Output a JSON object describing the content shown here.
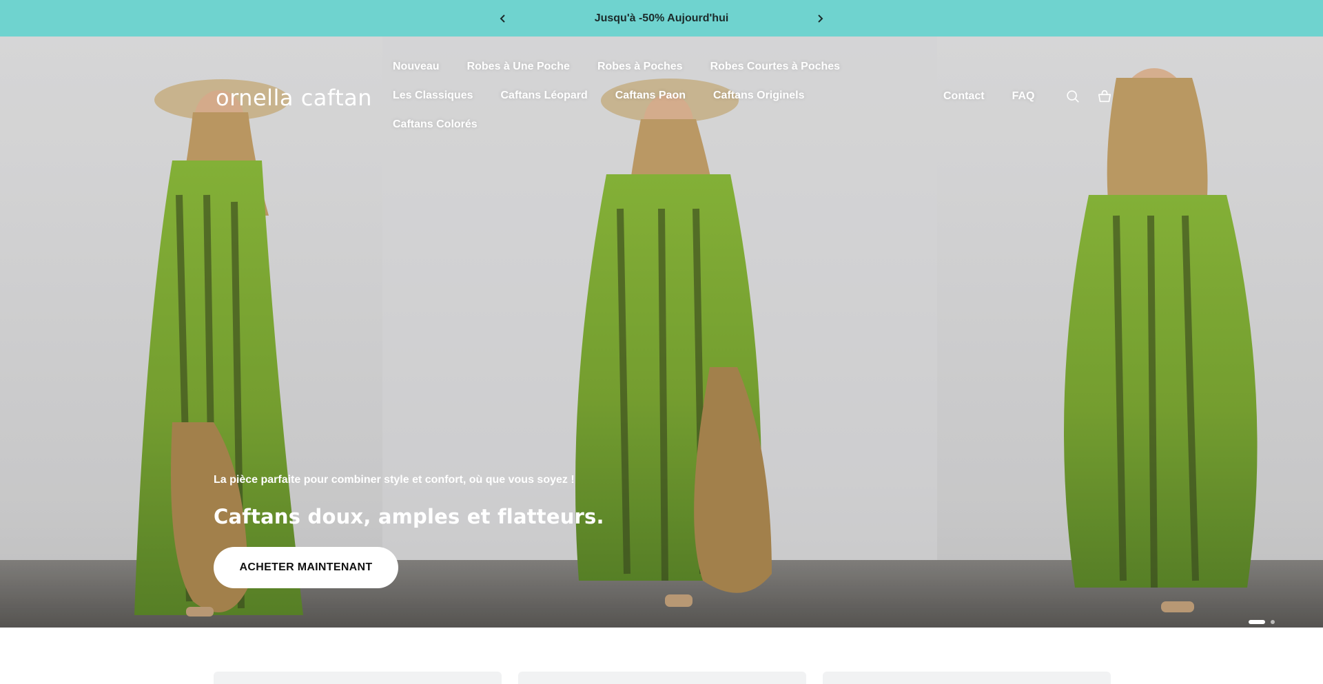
{
  "announcement": {
    "text": "Jusqu'à -50% Aujourd'hui"
  },
  "brand": {
    "logo": "ornella caftan"
  },
  "nav": {
    "items": [
      "Nouveau",
      "Robes à Une Poche",
      "Robes à Poches",
      "Robes Courtes à Poches",
      "Les Classiques",
      "Caftans Léopard",
      "Caftans Paon",
      "Caftans Originels",
      "Caftans Colorés"
    ],
    "right": [
      "Contact",
      "FAQ"
    ]
  },
  "hero": {
    "subtitle": "La pièce parfaite pour combiner style et confort, où que vous soyez !",
    "title": "Caftans doux, amples et flatteurs.",
    "cta": "ACHETER MAINTENANT",
    "slides": {
      "count": 2,
      "active": 1
    }
  },
  "colors": {
    "announcement_bg": "#6fd3cf",
    "dress_green": "#8bb83a",
    "wall": "#e4e4e4"
  },
  "icons": [
    "chevron-left-icon",
    "chevron-right-icon",
    "search-icon",
    "basket-icon"
  ]
}
